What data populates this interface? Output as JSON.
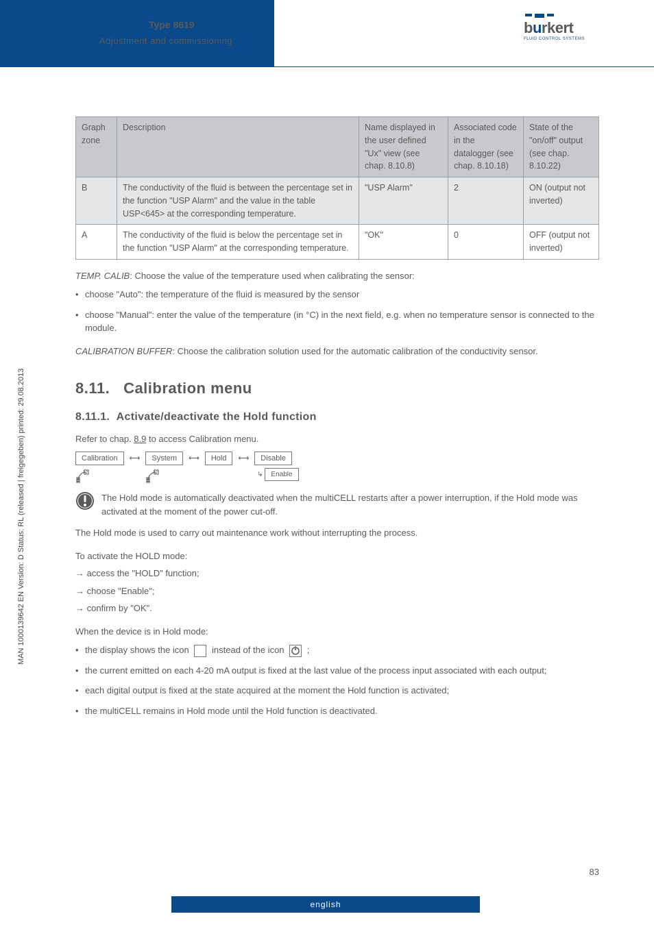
{
  "header": {
    "type": "Type 8619",
    "subtitle": "Adjustment and commissioning",
    "logo_name": "burkert",
    "logo_tag": "FLUID CONTROL SYSTEMS"
  },
  "side_text": "MAN 1000139642 EN Version: D Status: RL (released | freigegeben) printed: 29.08.2013",
  "table": {
    "headers": {
      "c1": "Graph zone",
      "c2": "Description",
      "c3": "Name displayed in the user defined \"Ux\" view (see chap. 8.10.8)",
      "c4": "Associated code in the datalogger (see chap. 8.10.18)",
      "c5": "State of the \"on/off\" output (see chap. 8.10.22)"
    },
    "rows": [
      {
        "zone": "B",
        "desc": "The conductivity of the fluid is between the percentage set in the function \"USP Alarm\" and the value in the table USP<645> at the corresponding temperature.",
        "name": "\"USP Alarm\"",
        "code": "2",
        "state": "ON (output not inverted)"
      },
      {
        "zone": "A",
        "desc": "The conductivity of the fluid is below the percentage set in the function \"USP Alarm\" at the corresponding temperature.",
        "name": "\"OK\"",
        "code": "0",
        "state": "OFF (output not inverted)"
      }
    ]
  },
  "tempcalib_intro": "TEMP. CALIB: Choose the value of the temperature used when calibrating the sensor:",
  "tempcalib_1": "choose \"Auto\": the temperature of the fluid is measured by the sensor",
  "tempcalib_2": "choose \"Manual\": enter the value of the temperature (in °C) in the next field, e.g. when no temperature sensor is connected to the module.",
  "calib_buffer": "CALIBRATION BUFFER: Choose the calibration solution used for the automatic calibration of the conductivity sensor.",
  "section": {
    "num": "8.11.",
    "title": "Calibration menu",
    "subnum": "8.11.1.",
    "subtitle": "Activate/deactivate the Hold function"
  },
  "refer": "Refer to chap. 8.9 to access Calibration menu.",
  "crumb": {
    "a": "Calibration",
    "b": "System",
    "c": "Hold",
    "d": "Disable",
    "e": "Enable"
  },
  "note": "The Hold mode is automatically deactivated when the multiCELL restarts after a power interruption, if the Hold mode was activated at the moment of the power cut-off.",
  "hold_intro": "The Hold mode is used to carry out maintenance work without interrupting the process.",
  "activate": "To activate the HOLD mode:",
  "steps": {
    "s1": "access the \"HOLD\" function;",
    "s2": "choose \"Enable\";",
    "s3": "confirm by \"OK\"."
  },
  "when": "When the device is in Hold mode:",
  "icon_line_a": "the display shows the icon",
  "icon_line_b": "instead of the icon",
  "icon_line_c": ";",
  "bullets": {
    "b2": "the current emitted on each 4-20 mA output is fixed at the last value of the process input associated with each output;",
    "b3": "each digital output is fixed at the state acquired at the moment the Hold function is activated;",
    "b4": "the multiCELL remains in Hold mode until the Hold function is deactivated."
  },
  "footer": "english",
  "page": "83"
}
